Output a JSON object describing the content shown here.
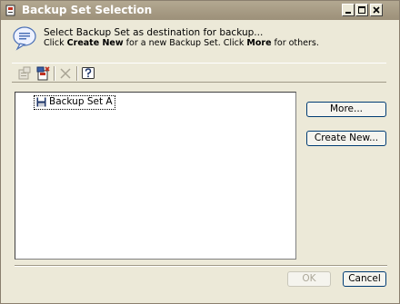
{
  "window": {
    "title": "Backup Set Selection"
  },
  "instruction": {
    "line1": "Select Backup Set as destination for backup...",
    "line2_pre": "Click ",
    "line2_create": "Create New",
    "line2_mid": " for a new Backup Set. Click ",
    "line2_more": "More",
    "line2_post": " for others."
  },
  "tree": {
    "items": [
      {
        "label": "Backup Set A"
      }
    ]
  },
  "buttons": {
    "more": "More...",
    "create_new": "Create New...",
    "ok": "OK",
    "cancel": "Cancel"
  },
  "colors": {
    "titlebar": "#9c9079",
    "dialog_bg": "#ece9d8",
    "button_border": "#003c74"
  }
}
